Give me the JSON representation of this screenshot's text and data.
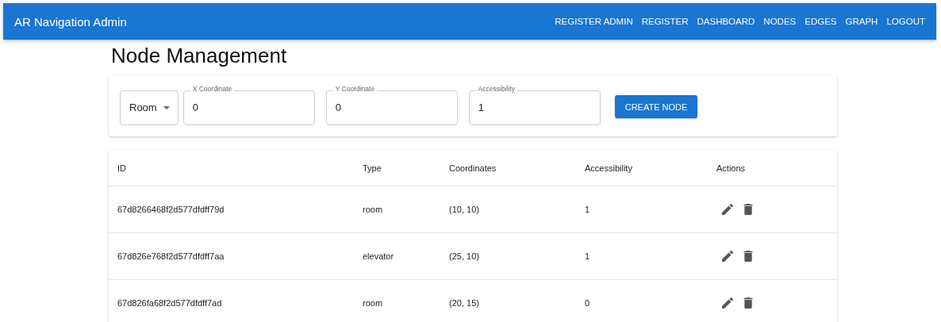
{
  "app_bar": {
    "title": "AR Navigation Admin",
    "nav": [
      {
        "label": "REGISTER ADMIN"
      },
      {
        "label": "REGISTER"
      },
      {
        "label": "DASHBOARD"
      },
      {
        "label": "NODES"
      },
      {
        "label": "EDGES"
      },
      {
        "label": "GRAPH"
      },
      {
        "label": "LOGOUT"
      }
    ]
  },
  "page_title": "Node Management",
  "form": {
    "type_select": {
      "value": "Room"
    },
    "fields": [
      {
        "label": "X Coordinate",
        "value": "0"
      },
      {
        "label": "Y Coordinate",
        "value": "0"
      },
      {
        "label": "Accessibility",
        "value": "1"
      }
    ],
    "submit": "CREATE NODE"
  },
  "table": {
    "columns": [
      "ID",
      "Type",
      "Coordinates",
      "Accessibility",
      "Actions"
    ],
    "rows": [
      {
        "id": "67d8266468f2d577dfdff79d",
        "type": "room",
        "coordinates": "(10, 10)",
        "accessibility": "1"
      },
      {
        "id": "67d826e768f2d577dfdff7aa",
        "type": "elevator",
        "coordinates": "(25, 10)",
        "accessibility": "1"
      },
      {
        "id": "67d826fa68f2d577dfdff7ad",
        "type": "room",
        "coordinates": "(20, 15)",
        "accessibility": "0"
      }
    ]
  }
}
